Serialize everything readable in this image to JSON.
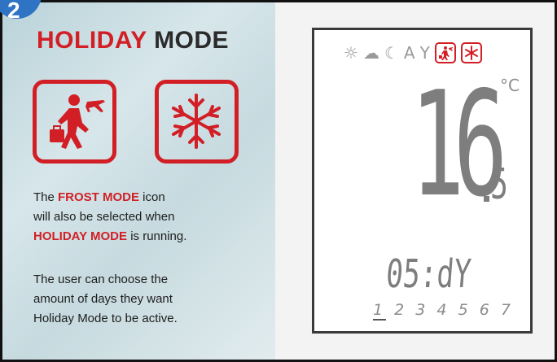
{
  "badge": {
    "number": "2"
  },
  "heading": {
    "part1": "HOLIDAY",
    "part2": "MODE"
  },
  "icons": {
    "holiday": "holiday-traveller-icon",
    "frost": "frost-snowflake-icon"
  },
  "description": {
    "para1": {
      "a": "The ",
      "b": "FROST MODE",
      "c": " icon",
      "d": "will also be selected when",
      "e": "HOLIDAY MODE",
      "f": " is running."
    },
    "para2": [
      "The user can choose the",
      "amount of days they want",
      "Holiday Mode to be active."
    ]
  },
  "display": {
    "status_icons": [
      "sun-icon",
      "cloud-icon",
      "moon-icon",
      "auto-icon",
      "cocktail-icon",
      "holiday-icon",
      "frost-icon"
    ],
    "auto_label": "A",
    "temperature_integer": "16",
    "temperature_decimal": "5",
    "unit": "°C",
    "days_value": "05:dY",
    "day_numbers": [
      "1",
      "2",
      "3",
      "4",
      "5",
      "6",
      "7"
    ],
    "selected_day": "1"
  },
  "colors": {
    "accent": "#d21f26",
    "lcd_segments": "#7e7e7e"
  }
}
